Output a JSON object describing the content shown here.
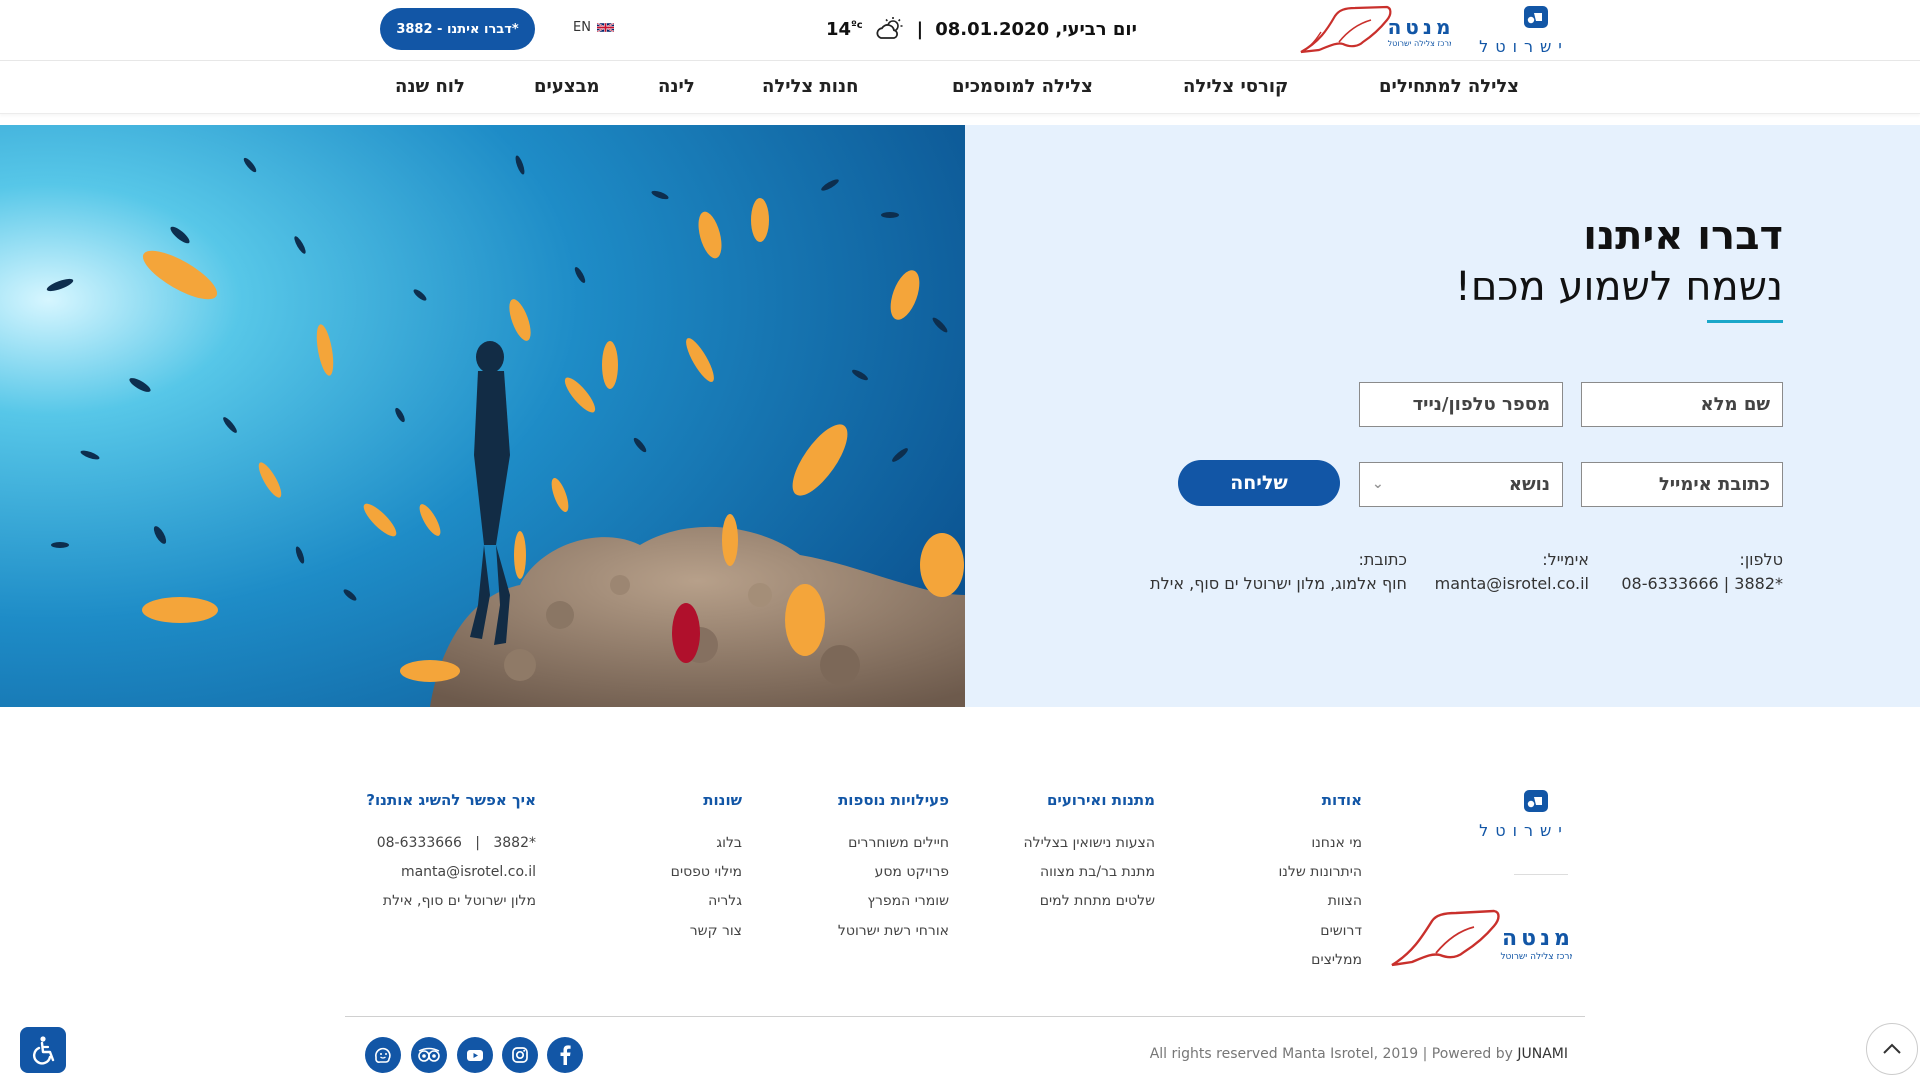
{
  "header": {
    "cta_label": "דברו איתנו - 3882*",
    "lang_label": "EN",
    "temperature": "14",
    "temp_unit": "ºc",
    "separator": "|",
    "date": "יום רביעי, 08.01.2020",
    "manta_logo_text": "מנטה",
    "manta_logo_sub": "מרכז צלילה ישרוטל",
    "isrotel_logo_text": "ישרוטל"
  },
  "nav": {
    "items": [
      {
        "label": "צלילה למתחילים"
      },
      {
        "label": "קורסי צלילה"
      },
      {
        "label": "צלילה למוסמכים"
      },
      {
        "label": "חנות צלילה"
      },
      {
        "label": "לינה"
      },
      {
        "label": "מבצעים"
      },
      {
        "label": "לוח שנה"
      }
    ]
  },
  "contact": {
    "title": "דברו איתנו",
    "subtitle": "נשמח לשמוע מכם!",
    "fields": {
      "full_name": "שם מלא",
      "phone": "מספר טלפון/נייד",
      "email": "כתובת אימייל",
      "subject": "נושא"
    },
    "submit_label": "שליחה",
    "phone_label": "טלפון:",
    "phone_value": "08-6333666 | 3882*",
    "email_label": "אימייל:",
    "email_value": "manta@isrotel.co.il",
    "address_label": "כתובת:",
    "address_value": "חוף אלמוג, מלון ישרוטל ים סוף, אילת"
  },
  "footer": {
    "isrotel_logo_text": "ישרוטל",
    "manta_logo_text": "מנטה",
    "manta_logo_sub": "מרכז צלילה ישרוטל",
    "columns": [
      {
        "title": "אודות",
        "links": [
          "מי אנחנו",
          "היתרונות שלנו",
          "הצוות",
          "דרושים",
          "ממליצים"
        ]
      },
      {
        "title": "מתנות ואירועים",
        "links": [
          "הצעות נישואין בצלילה",
          "מתנת בר/בת מצווה",
          "שלטים מתחת למים"
        ]
      },
      {
        "title": "פעילויות נוספות",
        "links": [
          "חיילים משוחררים",
          "פרויקט מסע",
          "שומרי המפרץ",
          "אורחי רשת ישרוטל"
        ]
      },
      {
        "title": "שונות",
        "links": [
          "בלוג",
          "מילוי טפסים",
          "גלריה",
          "צור קשר"
        ]
      },
      {
        "title": "איך אפשר להשיג אותנו?",
        "links": [
          "08-6333666   |   3882*",
          "manta@isrotel.co.il",
          "מלון ישרוטל ים סוף, אילת"
        ]
      }
    ],
    "copyright": "All rights reserved Manta Isrotel, 2019 | Powered by",
    "powered_by": "JUNAMI",
    "social": [
      "waze-icon",
      "tripadvisor-icon",
      "youtube-icon",
      "instagram-icon",
      "facebook-icon"
    ]
  },
  "colors": {
    "brand_blue": "#1256a6",
    "accent_cyan": "#1aa7c9",
    "panel_bg": "#e6f1fd"
  }
}
